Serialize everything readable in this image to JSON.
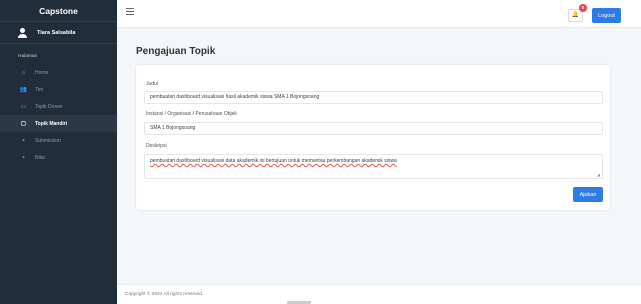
{
  "sidebar": {
    "brand": "Capstone",
    "user_name": "Tiara Salsabila",
    "section_label": "Halaman",
    "items": [
      {
        "label": "Home",
        "icon": "home-icon",
        "glyph": "⌂"
      },
      {
        "label": "Tim",
        "icon": "users-icon",
        "glyph": "👥"
      },
      {
        "label": "Topik Dosen",
        "icon": "chat-icon",
        "glyph": "▭"
      },
      {
        "label": "Topik Mandiri",
        "icon": "chat-bubble-icon",
        "glyph": "◻"
      },
      {
        "label": "Submission",
        "icon": "file-icon",
        "glyph": "▪"
      },
      {
        "label": "Nilai",
        "icon": "document-icon",
        "glyph": "▪"
      }
    ],
    "active_index": 3
  },
  "topbar": {
    "notification_count": "0",
    "logout_label": "Logout"
  },
  "main": {
    "title": "Pengajuan Topik",
    "form": {
      "judul_label": "Judul",
      "judul_value": "pembuatan dashboard visualisasi hasil akademik siswa SMA 1 Bojongsoang",
      "instansi_label": "Instansi / Organisasi / Perusahaan Objek",
      "instansi_value": "SMA 1 Bojongsoang",
      "deskripsi_label": "Deskripsi",
      "deskripsi_value": "pembuatan dashboard visualisasi data akademik ini bertujuan untuk memantau perkembangan akademik siswa",
      "submit_label": "Ajukan"
    }
  },
  "footer": {
    "copyright": "Copyright © 2024 All rights reserved."
  },
  "colors": {
    "sidebar_bg": "#222d3a",
    "accent": "#2f7be5",
    "badge": "#e64545"
  }
}
